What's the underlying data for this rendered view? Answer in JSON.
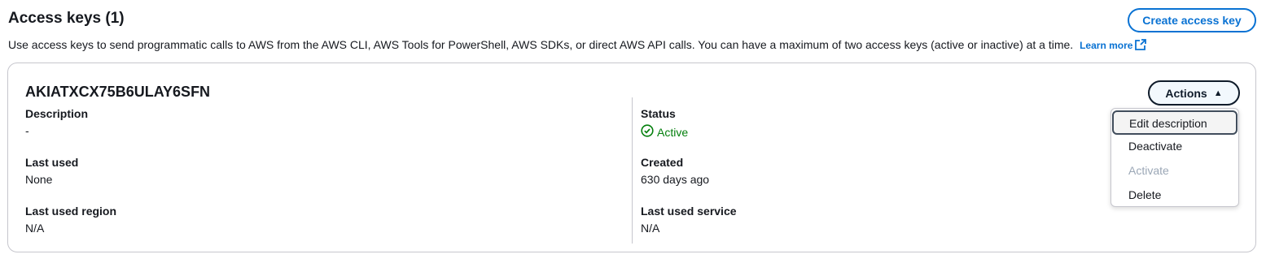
{
  "header": {
    "title": "Access keys (1)",
    "create_button": "Create access key",
    "description": "Use access keys to send programmatic calls to AWS from the AWS CLI, AWS Tools for PowerShell, AWS SDKs, or direct AWS API calls. You can have a maximum of two access keys (active or inactive) at a time.",
    "learn_more": "Learn more"
  },
  "key": {
    "id": "AKIATXCX75B6ULAY6SFN",
    "actions_label": "Actions",
    "left": [
      {
        "label": "Description",
        "value": "-"
      },
      {
        "label": "Last used",
        "value": "None"
      },
      {
        "label": "Last used region",
        "value": "N/A"
      }
    ],
    "right": {
      "status_label": "Status",
      "status_value": "Active",
      "created_label": "Created",
      "created_value": "630 days ago",
      "service_label": "Last used service",
      "service_value": "N/A"
    }
  },
  "menu": {
    "items": [
      {
        "label": "Edit description",
        "state": "focused"
      },
      {
        "label": "Deactivate",
        "state": "enabled"
      },
      {
        "label": "Activate",
        "state": "disabled"
      },
      {
        "label": "Delete",
        "state": "enabled"
      }
    ]
  },
  "colors": {
    "link": "#0972d3",
    "success": "#037f0c",
    "text": "#16191f",
    "disabled": "#9ba7b6"
  },
  "icons": {
    "external": "external-link-icon",
    "status": "check-circle-icon",
    "caret": "caret-up-icon"
  }
}
